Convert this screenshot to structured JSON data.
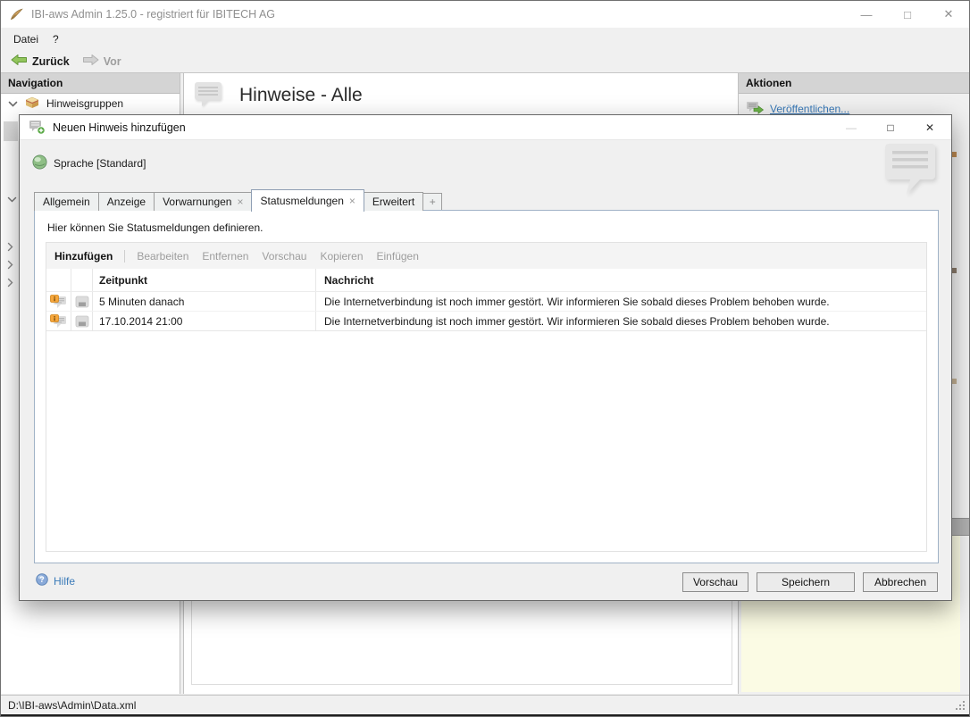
{
  "colors": {
    "link_blue": "#3a7ab8",
    "accent_green": "#7cb94e",
    "badge_orange": "#f2a23a",
    "preview_yellow": "#fbfbe4",
    "panel_header_gray": "#d4d4d4"
  },
  "glyphs": {
    "minimize": "—",
    "maximize": "□",
    "close": "✕",
    "tab_close": "×",
    "tab_plus": "+",
    "help_mark": "?"
  },
  "main_window": {
    "title": "IBI-aws Admin 1.25.0 - registriert für IBITECH AG",
    "menu": {
      "datei": "Datei",
      "help": "?"
    },
    "toolbar": {
      "back": "Zurück",
      "forward": "Vor"
    },
    "navigation": {
      "header": "Navigation",
      "root_item": "Hinweisgruppen"
    },
    "content": {
      "title": "Hinweise - Alle"
    },
    "actions": {
      "header": "Aktionen",
      "publish_link": "Veröffentlichen..."
    },
    "statusbar": {
      "path": "D:\\IBI-aws\\Admin\\Data.xml"
    }
  },
  "dialog": {
    "title": "Neuen Hinweis hinzufügen",
    "language_label": "Sprache [Standard]",
    "tabs": [
      {
        "label": "Allgemein"
      },
      {
        "label": "Anzeige"
      },
      {
        "label": "Vorwarnungen",
        "close": "×"
      },
      {
        "label": "Statusmeldungen",
        "close": "×"
      },
      {
        "label": "Erweitert"
      },
      {
        "label": "+"
      }
    ],
    "description": "Hier können Sie Statusmeldungen definieren.",
    "list_toolbar": {
      "items": [
        {
          "label": "Hinzufügen"
        },
        {
          "label": "Bearbeiten"
        },
        {
          "label": "Entfernen"
        },
        {
          "label": "Vorschau"
        },
        {
          "label": "Kopieren"
        },
        {
          "label": "Einfügen"
        }
      ]
    },
    "table": {
      "columns": {
        "time": "Zeitpunkt",
        "message": "Nachricht"
      },
      "rows": [
        {
          "time": "5 Minuten danach",
          "message": "Die Internetverbindung ist noch immer gestört. Wir informieren Sie sobald dieses Problem behoben wurde."
        },
        {
          "time": "17.10.2014 21:00",
          "message": "Die Internetverbindung ist noch immer gestört. Wir informieren Sie sobald dieses Problem behoben wurde."
        }
      ]
    },
    "footer": {
      "help": "Hilfe",
      "buttons": [
        {
          "label": "Vorschau"
        },
        {
          "label": "Speichern"
        },
        {
          "label": "Abbrechen"
        }
      ]
    }
  }
}
